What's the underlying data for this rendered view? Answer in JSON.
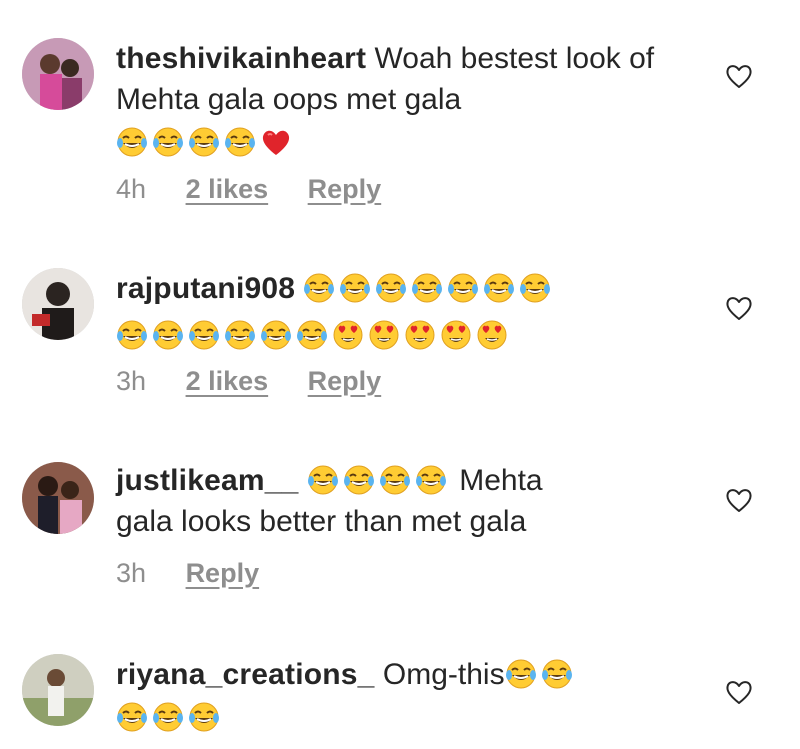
{
  "comments": [
    {
      "username": "theshivikainheart",
      "text": "Woah bestest look of Mehta gala oops met gala",
      "emojis": [
        "joy",
        "joy",
        "joy",
        "joy",
        "heart"
      ],
      "time": "4h",
      "likes": "2 likes",
      "reply": "Reply"
    },
    {
      "username": "rajputani908",
      "text": "",
      "emojis_line1": [
        "joy",
        "joy",
        "joy",
        "joy",
        "joy",
        "joy",
        "joy"
      ],
      "emojis_line2": [
        "joy",
        "joy",
        "joy",
        "joy",
        "joy",
        "joy",
        "heart-eyes",
        "heart-eyes",
        "heart-eyes",
        "heart-eyes",
        "heart-eyes"
      ],
      "time": "3h",
      "likes": "2 likes",
      "reply": "Reply"
    },
    {
      "username": "justlikeam__",
      "text_after": "Mehta",
      "text_line2": "gala looks better than met gala",
      "emojis": [
        "joy",
        "joy",
        "joy",
        "joy"
      ],
      "time": "3h",
      "reply": "Reply"
    },
    {
      "username": "riyana_creations_",
      "text": "Omg-this",
      "emojis_inline": [
        "joy",
        "joy"
      ],
      "emojis_line2": [
        "joy",
        "joy",
        "joy"
      ]
    }
  ],
  "icons": {
    "like": "heart-outline-icon"
  },
  "colors": {
    "text": "#262626",
    "meta": "#8e8e8e"
  }
}
